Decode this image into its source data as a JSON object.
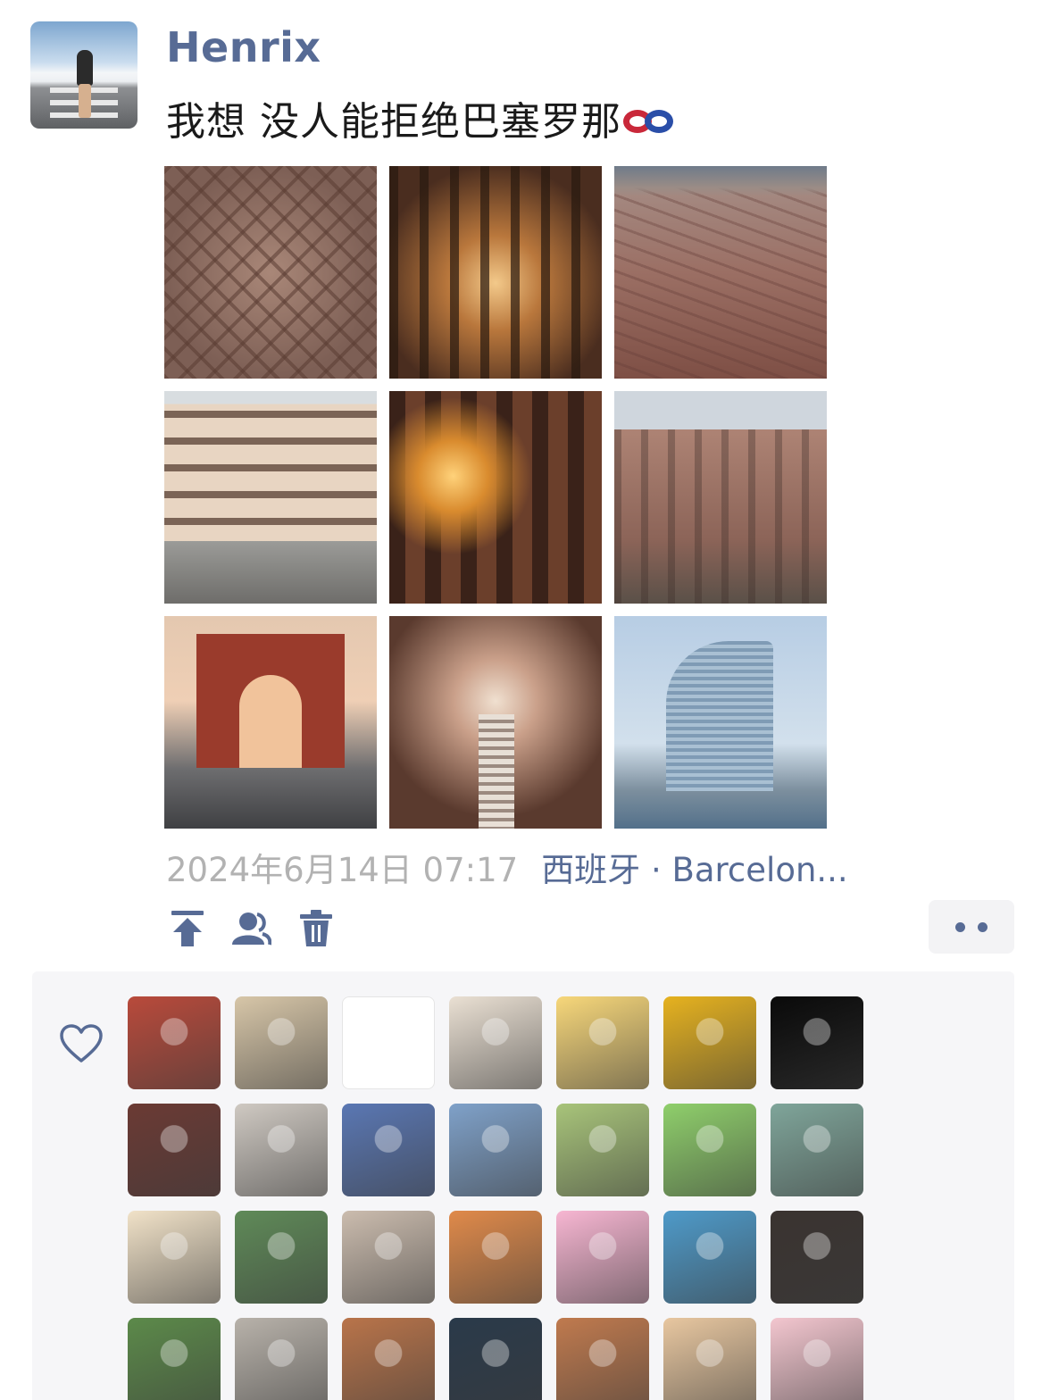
{
  "author": {
    "name": "Henrix"
  },
  "post": {
    "caption": "我想 没人能拒绝巴塞罗那",
    "caption_emoji": "knot-emoji",
    "photos": [
      {
        "subject": "aerial-city-photo"
      },
      {
        "subject": "cathedral-ceiling-photo"
      },
      {
        "subject": "city-skyline-photo"
      },
      {
        "subject": "wavy-building-photo"
      },
      {
        "subject": "stained-glass-interior-photo"
      },
      {
        "subject": "ornate-facade-photo"
      },
      {
        "subject": "triumphal-arch-photo"
      },
      {
        "subject": "vaulted-nave-photo"
      },
      {
        "subject": "sail-hotel-photo"
      }
    ],
    "timestamp": "2024年6月14日 07:17",
    "location": "西班牙 · Barcelon..."
  },
  "actions": {
    "icons": [
      "pin-top-icon",
      "visibility-people-icon",
      "trash-icon"
    ],
    "more_icon": "more-dots-icon"
  },
  "likes": {
    "icon": "heart-outline-icon",
    "avatars": [
      {
        "color": "#b94a3b"
      },
      {
        "color": "#d7c6a8"
      },
      {
        "color": "#111111"
      },
      {
        "color": "#eae0d3"
      },
      {
        "color": "#f7d77a"
      },
      {
        "color": "#e6b21f"
      },
      {
        "color": "#0a0a0a"
      },
      {
        "color": "#6b3a34"
      },
      {
        "color": "#cfc9c2"
      },
      {
        "color": "#5a77b3"
      },
      {
        "color": "#7fa1c9"
      },
      {
        "color": "#a8c47a"
      },
      {
        "color": "#8fcf6b"
      },
      {
        "color": "#7fa59a"
      },
      {
        "color": "#f1e2c8"
      },
      {
        "color": "#5f8a58"
      },
      {
        "color": "#cbbcae"
      },
      {
        "color": "#e08a4a"
      },
      {
        "color": "#f7b6d2"
      },
      {
        "color": "#4e9ac9"
      },
      {
        "color": "#3a3330"
      },
      {
        "color": "#5c8a4a"
      },
      {
        "color": "#b8b2aa"
      },
      {
        "color": "#b9744a"
      },
      {
        "color": "#2a3a4a"
      },
      {
        "color": "#c07a4e"
      },
      {
        "color": "#e8c7a0"
      },
      {
        "color": "#f3c6cf"
      }
    ]
  },
  "colors": {
    "link": "#576b95",
    "meta_gray": "#b2b2b2",
    "panel": "#f6f6f8"
  }
}
